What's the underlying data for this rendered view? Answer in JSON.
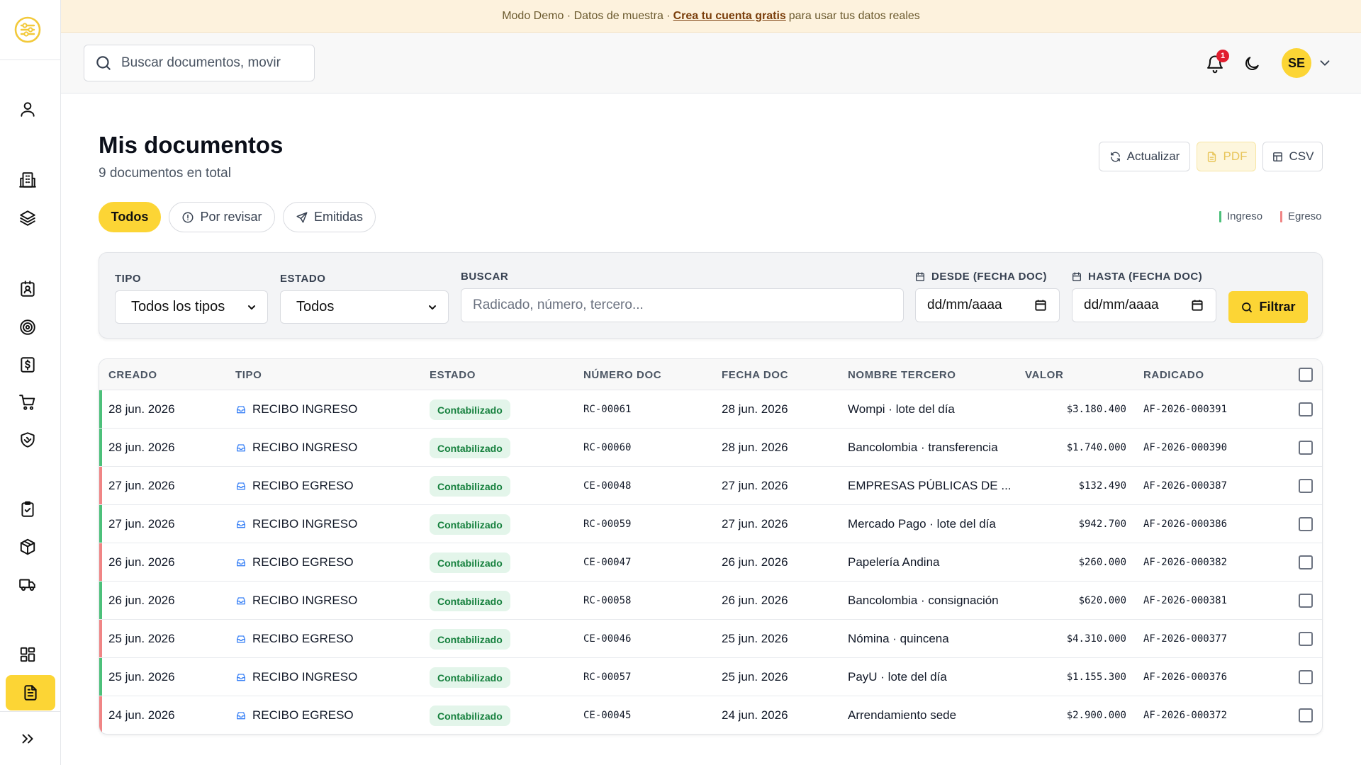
{
  "banner": {
    "prefix": "Modo Demo · Datos de muestra ·",
    "link": "Crea tu cuenta gratis",
    "suffix": "para usar tus datos reales"
  },
  "topbar": {
    "search_placeholder": "Buscar documentos, movir",
    "notification_count": "1",
    "avatar_initials": "SE"
  },
  "page": {
    "title": "Mis documentos",
    "subtitle": "9 documentos en total"
  },
  "actions": {
    "refresh": "Actualizar",
    "pdf": "PDF",
    "csv": "CSV"
  },
  "tabs": [
    {
      "label": "Todos"
    },
    {
      "label": "Por revisar"
    },
    {
      "label": "Emitidas"
    }
  ],
  "legend": {
    "income": "Ingreso",
    "expense": "Egreso",
    "income_color": "#4cc07a",
    "expense_color": "#f08585"
  },
  "filters": {
    "type_label": "TIPO",
    "type_value": "Todos los tipos",
    "status_label": "ESTADO",
    "status_value": "Todos",
    "search_label": "BUSCAR",
    "search_placeholder": "Radicado, número, tercero...",
    "from_label": "DESDE (FECHA DOC)",
    "from_placeholder": "dd/mm/aaaa",
    "to_label": "HASTA (FECHA DOC)",
    "to_placeholder": "dd/mm/aaaa",
    "submit": "Filtrar"
  },
  "table": {
    "columns": [
      "CREADO",
      "TIPO",
      "ESTADO",
      "NÚMERO DOC",
      "FECHA DOC",
      "NOMBRE TERCERO",
      "VALOR",
      "RADICADO"
    ],
    "rows": [
      {
        "created": "28 jun. 2026",
        "type": "RECIBO INGRESO",
        "status": "Contabilizado",
        "number": "RC-00061",
        "date": "28 jun. 2026",
        "party": "Wompi · lote del día",
        "value": "$3.180.400",
        "radicado": "AF-2026-000391",
        "kind": "ingreso"
      },
      {
        "created": "28 jun. 2026",
        "type": "RECIBO INGRESO",
        "status": "Contabilizado",
        "number": "RC-00060",
        "date": "28 jun. 2026",
        "party": "Bancolombia · transferencia",
        "value": "$1.740.000",
        "radicado": "AF-2026-000390",
        "kind": "ingreso"
      },
      {
        "created": "27 jun. 2026",
        "type": "RECIBO EGRESO",
        "status": "Contabilizado",
        "number": "CE-00048",
        "date": "27 jun. 2026",
        "party": "EMPRESAS PÚBLICAS DE ...",
        "value": "$132.490",
        "radicado": "AF-2026-000387",
        "kind": "egreso"
      },
      {
        "created": "27 jun. 2026",
        "type": "RECIBO INGRESO",
        "status": "Contabilizado",
        "number": "RC-00059",
        "date": "27 jun. 2026",
        "party": "Mercado Pago · lote del día",
        "value": "$942.700",
        "radicado": "AF-2026-000386",
        "kind": "ingreso"
      },
      {
        "created": "26 jun. 2026",
        "type": "RECIBO EGRESO",
        "status": "Contabilizado",
        "number": "CE-00047",
        "date": "26 jun. 2026",
        "party": "Papelería Andina",
        "value": "$260.000",
        "radicado": "AF-2026-000382",
        "kind": "egreso"
      },
      {
        "created": "26 jun. 2026",
        "type": "RECIBO INGRESO",
        "status": "Contabilizado",
        "number": "RC-00058",
        "date": "26 jun. 2026",
        "party": "Bancolombia · consignación",
        "value": "$620.000",
        "radicado": "AF-2026-000381",
        "kind": "ingreso"
      },
      {
        "created": "25 jun. 2026",
        "type": "RECIBO EGRESO",
        "status": "Contabilizado",
        "number": "CE-00046",
        "date": "25 jun. 2026",
        "party": "Nómina · quincena",
        "value": "$4.310.000",
        "radicado": "AF-2026-000377",
        "kind": "egreso"
      },
      {
        "created": "25 jun. 2026",
        "type": "RECIBO INGRESO",
        "status": "Contabilizado",
        "number": "RC-00057",
        "date": "25 jun. 2026",
        "party": "PayU · lote del día",
        "value": "$1.155.300",
        "radicado": "AF-2026-000376",
        "kind": "ingreso"
      },
      {
        "created": "24 jun. 2026",
        "type": "RECIBO EGRESO",
        "status": "Contabilizado",
        "number": "CE-00045",
        "date": "24 jun. 2026",
        "party": "Arrendamiento sede",
        "value": "$2.900.000",
        "radicado": "AF-2026-000372",
        "kind": "egreso"
      }
    ]
  },
  "sidebar": {
    "icons": [
      "user-icon",
      "building-icon",
      "layers-icon",
      "contact-card-icon",
      "target-icon",
      "invoice-dollar-icon",
      "cart-icon",
      "shield-handshake-icon",
      "clipboard-check-icon",
      "package-icon",
      "truck-icon",
      "dashboard-grid-icon",
      "document-icon",
      "expand-icon"
    ],
    "active_color": "#fcd535"
  }
}
